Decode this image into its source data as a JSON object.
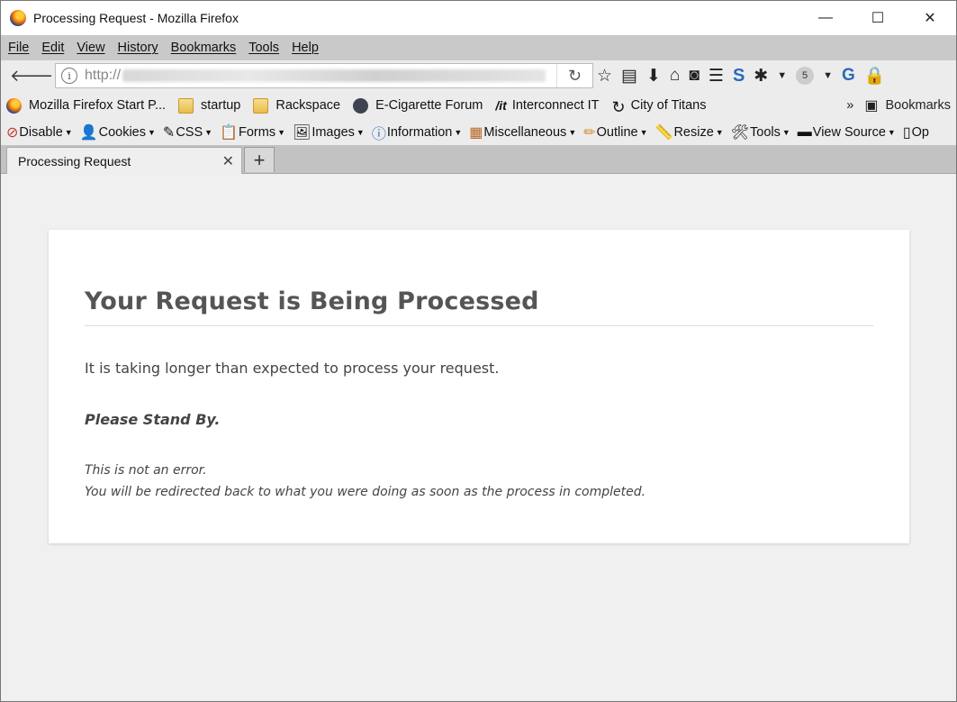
{
  "window": {
    "title": "Processing Request - Mozilla Firefox",
    "controls": [
      "—",
      "☐",
      "✕"
    ]
  },
  "menubar": [
    "File",
    "Edit",
    "View",
    "History",
    "Bookmarks",
    "Tools",
    "Help"
  ],
  "navbar": {
    "url_prefix": "http://",
    "counter_badge": "5"
  },
  "bookmarks": {
    "items": [
      {
        "label": "Mozilla Firefox Start P...",
        "icon": "firefox-icon"
      },
      {
        "label": "startup",
        "icon": "folder-icon"
      },
      {
        "label": "Rackspace",
        "icon": "folder-icon"
      },
      {
        "label": "E-Cigarette Forum",
        "icon": "ecf-icon"
      },
      {
        "label": "Interconnect IT",
        "icon": "it-icon"
      },
      {
        "label": "City of Titans",
        "icon": "cot-icon"
      }
    ],
    "overflow": "»",
    "bookmarks_menu": "Bookmarks"
  },
  "devtoolbar": [
    "Disable",
    "Cookies",
    "CSS",
    "Forms",
    "Images",
    "Information",
    "Miscellaneous",
    "Outline",
    "Resize",
    "Tools",
    "View Source",
    "Op"
  ],
  "tab": {
    "title": "Processing Request"
  },
  "page": {
    "heading": "Your Request is Being Processed",
    "message": "It is taking longer than expected to process your request.",
    "stand_by": "Please Stand By.",
    "note_line1": "This is not an error.",
    "note_line2": "You will be redirected back to what you were doing as soon as the process in completed."
  }
}
